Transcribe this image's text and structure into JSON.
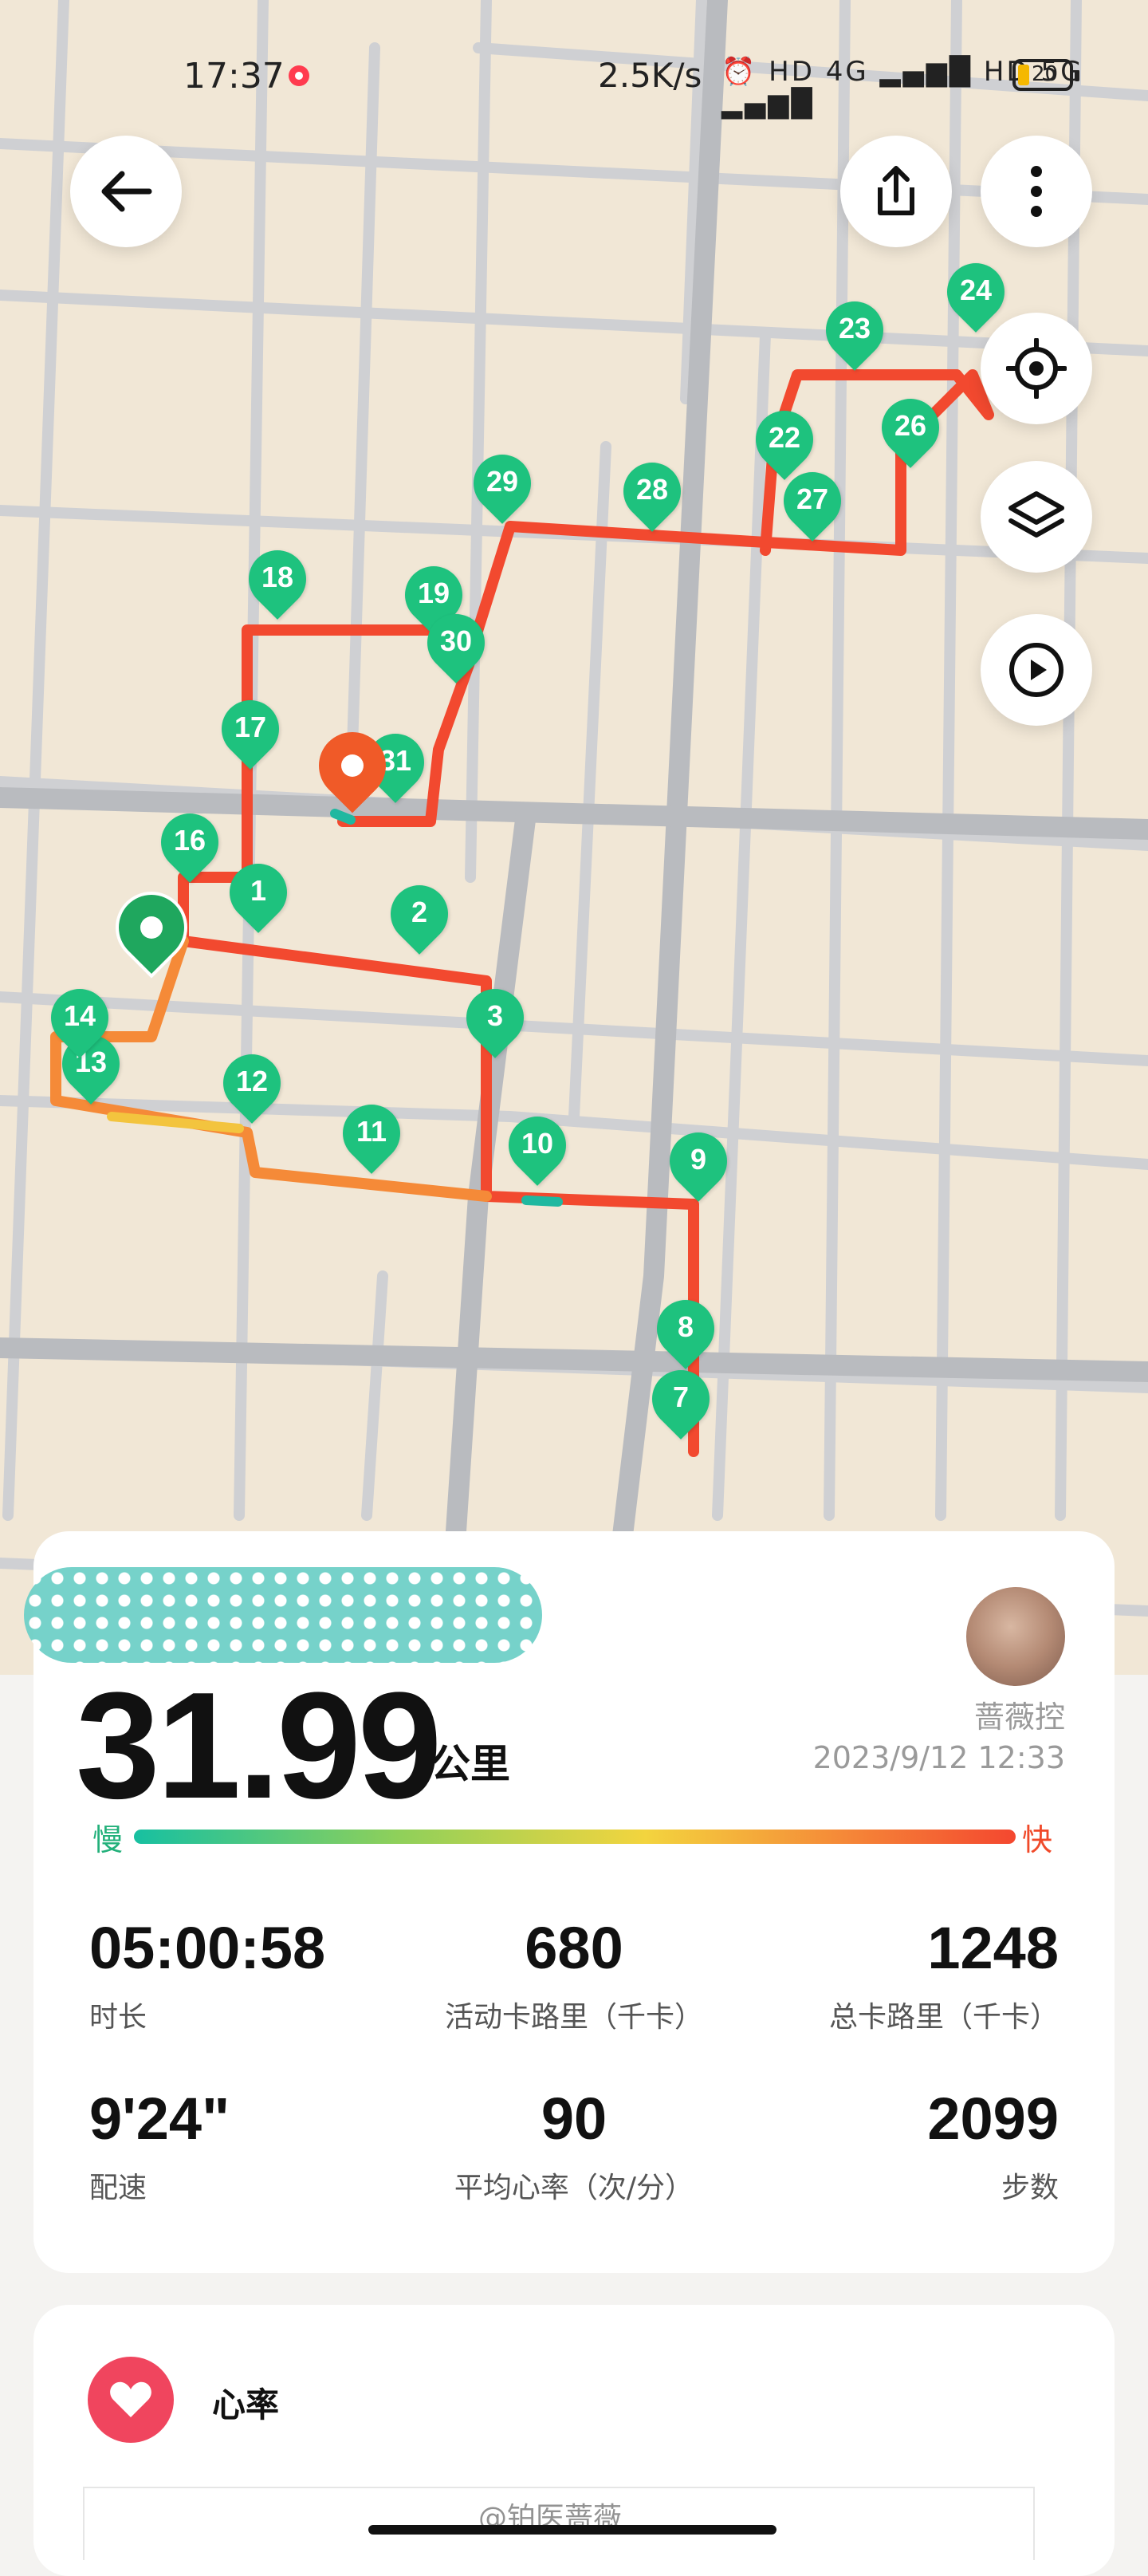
{
  "status_bar": {
    "time": "17:37",
    "network_speed": "2.5K/s",
    "icons": "⏰ HD 4G ▂▄▆█ HD 5G ▂▄▆█",
    "battery": "20"
  },
  "map": {
    "buttons": [
      {
        "name": "back",
        "icon": "arrow-left-icon"
      },
      {
        "name": "share",
        "icon": "share-icon"
      },
      {
        "name": "more",
        "icon": "more-vertical-icon"
      },
      {
        "name": "locate",
        "icon": "target-icon"
      },
      {
        "name": "layers",
        "icon": "layers-icon"
      },
      {
        "name": "playback",
        "icon": "play-icon"
      }
    ],
    "km_markers": [
      "1",
      "2",
      "3",
      "7",
      "8",
      "9",
      "10",
      "11",
      "12",
      "13",
      "14",
      "16",
      "17",
      "18",
      "19",
      "22",
      "23",
      "24",
      "26",
      "27",
      "28",
      "29",
      "30",
      "31"
    ]
  },
  "summary": {
    "distance": "31.99",
    "distance_unit": "公里",
    "user_name": "蔷薇控",
    "date": "2023/9/12 12:33",
    "pace_slow": "慢",
    "pace_fast": "快",
    "stats": [
      {
        "value": "05:00:58",
        "label": "时长"
      },
      {
        "value": "680",
        "label": "活动卡路里（千卡）"
      },
      {
        "value": "1248",
        "label": "总卡路里（千卡）"
      },
      {
        "value": "9'24\"",
        "label": "配速"
      },
      {
        "value": "90",
        "label": "平均心率（次/分）"
      },
      {
        "value": "2099",
        "label": "步数"
      }
    ],
    "colors": {
      "slow": "#22b07a",
      "fast": "#f04a2a",
      "accent": "#1ec27e"
    }
  },
  "heart_rate": {
    "title": "心率",
    "watermark": "@铂医蔷薇"
  }
}
